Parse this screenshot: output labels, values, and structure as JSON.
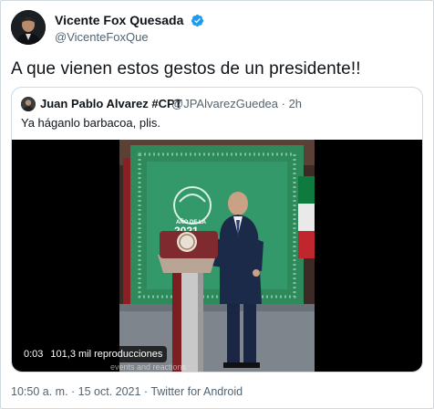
{
  "tweet": {
    "author": {
      "display_name": "Vicente Fox Quesada",
      "handle": "@VicenteFoxQue",
      "verified": true,
      "verified_color": "#1d9bf0"
    },
    "text": "A que vienen estos gestos de un presidente!!",
    "quoted": {
      "display_name": "Juan Pablo Alvarez #CPT",
      "handle_time": "@JPAlvarezGuedea · 2h",
      "text": "Ya háganlo barbacoa, plis.",
      "video": {
        "duration": "0:03",
        "views": "101,3 mil reproducciones",
        "caption": "events and reactions",
        "backdrop_text": "AÑO DE LA",
        "backdrop_year": "2021"
      }
    },
    "timestamp": "10:50 a. m. · 15 oct. 2021 · Twitter for Android"
  }
}
